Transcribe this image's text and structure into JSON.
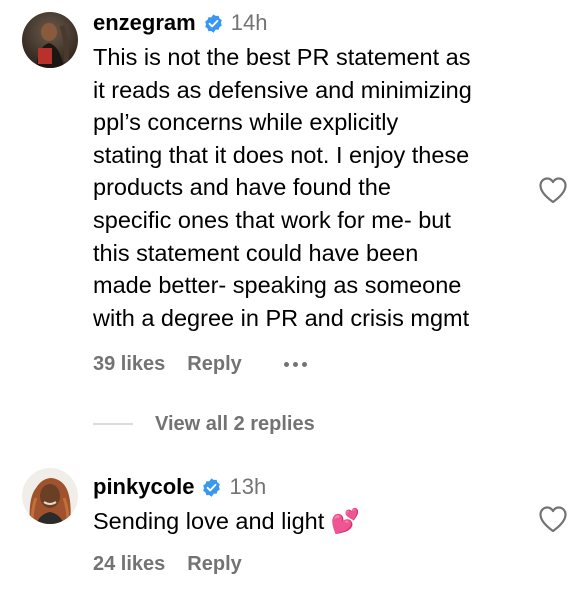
{
  "comments": [
    {
      "username": "enzegram",
      "time": "14h",
      "text_lines": [
        "This is not the best PR statement as",
        "it reads as defensive and minimizing",
        "ppl’s concerns while explicitly",
        "stating that it does not. I enjoy these",
        "products and have found the",
        "specific ones that work for me- but",
        "this statement could have been",
        "made better- speaking as someone",
        "with a degree in PR and crisis mgmt"
      ],
      "likes": "39 likes",
      "reply_label": "Reply",
      "avatar_icon": "profile-photo",
      "verified_icon": "verified-badge-icon",
      "like_icon": "heart-outline-icon"
    },
    {
      "username": "pinkycole",
      "time": "13h",
      "text": "Sending love and light 💕",
      "likes": "24 likes",
      "reply_label": "Reply",
      "avatar_icon": "profile-photo",
      "verified_icon": "verified-badge-icon",
      "like_icon": "heart-outline-icon"
    }
  ],
  "view_replies_label": "View all 2 replies",
  "colors": {
    "verified_blue": "#3897f0",
    "secondary_text": "#737373",
    "divider": "#dbdbdb"
  }
}
